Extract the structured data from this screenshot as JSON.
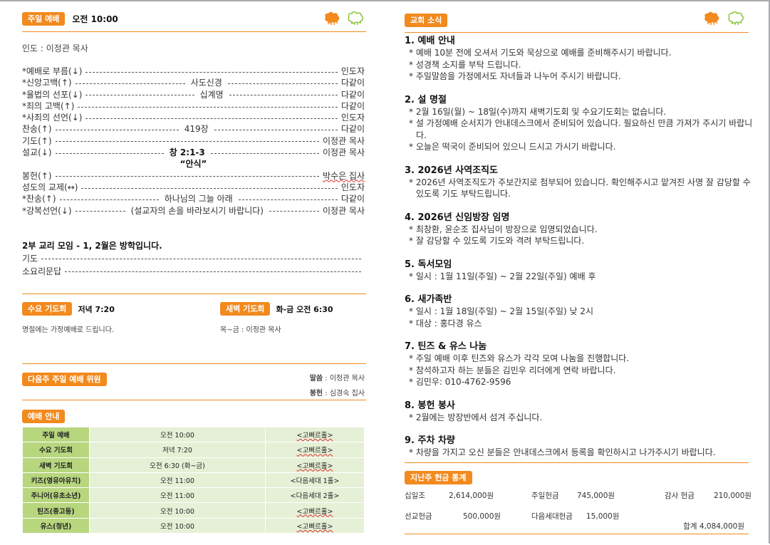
{
  "left": {
    "sunday": {
      "badge": "주일 예배",
      "time": "오전 10:00",
      "leader": "인도 : 이정관 목사"
    },
    "order": [
      {
        "item": "*예배로  부름(↓)",
        "mid": "",
        "who": "인도자"
      },
      {
        "item": "*신앙고백(↑)",
        "mid": "사도신경",
        "who": "다같이"
      },
      {
        "item": "*율법의 선포(↓)",
        "mid": "십계명",
        "who": "다같이"
      },
      {
        "item": "*죄의  고백(↑)",
        "mid": "",
        "who": "다같이"
      },
      {
        "item": "*사죄의  선언(↓)",
        "mid": "",
        "who": "인도자"
      },
      {
        "item": "찬송(↑)",
        "mid": "419장",
        "who": "다같이"
      },
      {
        "item": "기도(↑)",
        "mid": "",
        "who": "이정관  목사"
      },
      {
        "item": "설교(↓)",
        "mid": "창 2:1-3",
        "who": "이정관  목사"
      },
      {
        "item": "",
        "mid": "“안식”",
        "who": ""
      },
      {
        "item": "봉헌(↑)",
        "mid": "",
        "who": "박수은  집사"
      },
      {
        "item": "성도의  교제(↔)",
        "mid": "",
        "who": "인도자"
      },
      {
        "item": "*찬송(↑)",
        "mid": "하나님의  그늘  아래",
        "who": "다같이"
      },
      {
        "item": "*강복선언(↓)",
        "mid": "(설교자의  손을  바라보시기  바랍니다)",
        "who": "이정관  목사"
      }
    ],
    "catechism": {
      "title": "2부 교리 모임  - 1, 2월은 방학입니다.",
      "items": [
        "기도",
        "소요리문답"
      ]
    },
    "wednesday": {
      "badge": "수요 기도회",
      "time": "저녁 7:20",
      "note": "명절에는 가정예배로 드립니다."
    },
    "dawn": {
      "badge": "새벽 기도회",
      "time": "화-금 오전 6:30",
      "note": "목~금 : 이정관 목사"
    },
    "next_week": {
      "badge": "다음주 주일 예배 위원",
      "sermon_label": "말씀",
      "sermon": " : 이정관 목사",
      "offering_label": "봉헌",
      "offering": " : 심경숙 집사"
    },
    "schedule": {
      "badge": "예배 안내",
      "rows": [
        [
          "주일 예배",
          "오전 10:00",
          "<고삐르홀>"
        ],
        [
          "수요 기도회",
          "저녁 7:20",
          "<고삐르홀>"
        ],
        [
          "새벽 기도회",
          "오전 6:30 (화~금)",
          "<고삐르홀>"
        ],
        [
          "키즈(영유아유치)",
          "오전 11:00",
          "<다음세대 1홀>"
        ],
        [
          "주니어(유초소년)",
          "오전 11:00",
          "<다음세대 2홀>"
        ],
        [
          "틴즈(중고등)",
          "오전 10:00",
          "<고삐르홀>"
        ],
        [
          "유스(청년)",
          "오전 10:00",
          "<고삐르홀>"
        ]
      ]
    }
  },
  "right": {
    "badge": "교회 소식",
    "news": [
      {
        "title": "1. 예배 안내",
        "lines": [
          "* 예배 10분 전에 오셔서 기도와 묵상으로 예배를 준비해주시기 바랍니다.",
          "* 성경책 소지를 부탁 드립니다.",
          "* 주일말씀을 가정에서도 자녀들과 나누어 주시기 바랍니다."
        ]
      },
      {
        "title": "2. 설 명절",
        "lines": [
          "* 2월 16일(월) ~ 18일(수)까지 새벽기도회 및 수요기도회는 없습니다.",
          "* 설 가정예배 순서지가 안내데스크에서 준비되어 있습니다. 필요하신 만큼 가져가 주시기 바랍니다.",
          "* 오늘은 떡국이 준비되어 있으니 드시고 가시기 바랍니다."
        ]
      },
      {
        "title": "3. 2026년 사역조직도",
        "lines": [
          "* 2026년 사역조직도가 주보간지로 첨부되어 있습니다. 확인해주시고 맡겨진 사명 잘 감당할 수 있도록 기도 부탁드립니다."
        ]
      },
      {
        "title": "4. 2026년 신임방장 임명",
        "lines": [
          "* 최창환, 윤순조 집사님이 방장으로 임명되었습니다.",
          "* 잘 감당할 수 있도록 기도와 격려 부탁드립니다."
        ]
      },
      {
        "title": "5. 독서모임",
        "lines": [
          "* 일시 : 1월 11일(주일) ~ 2월 22일(주일) 예배 후"
        ]
      },
      {
        "title": "6. 새가족반",
        "lines": [
          "* 일시 : 1월 18일(주일) ~ 2월 15일(주일) 낮 2시",
          "* 대상 : 홍다경 유스"
        ]
      },
      {
        "title": "7. 틴즈 & 유스 나눔",
        "lines": [
          "* 주일 예배 이후 틴즈와 유스가 각각 모여 나눔을 진행합니다.",
          "* 참석하고자 하는 분들은 김민우 리더에게 연락 바랍니다.",
          "* 김민우: 010-4762-9596"
        ]
      },
      {
        "title": "8. 봉헌 봉사",
        "lines": [
          "* 2월에는 방장반에서 섬겨 주십니다."
        ]
      },
      {
        "title": "9. 주차 차량",
        "lines": [
          "* 차량을 가지고 오신 분들은 안내데스크에서 등록을 확인하시고 나가주시기 바랍니다."
        ]
      }
    ],
    "stats": {
      "badge": "지난주 헌금 통계",
      "items": [
        {
          "label": "십일조",
          "value": "2,614,000원"
        },
        {
          "label": "주일헌금",
          "value": "745,000원"
        },
        {
          "label": "감사 헌금",
          "value": "210,000원"
        },
        {
          "label": "선교헌금",
          "value": "500,000원"
        },
        {
          "label": "다음세대헌금",
          "value": "15,000원"
        }
      ],
      "total": "합계 4,084,000원"
    }
  },
  "colors": {
    "accent": "#f28a1e",
    "table_head": "#b7d67e",
    "table_cell": "#e6f0d6"
  }
}
